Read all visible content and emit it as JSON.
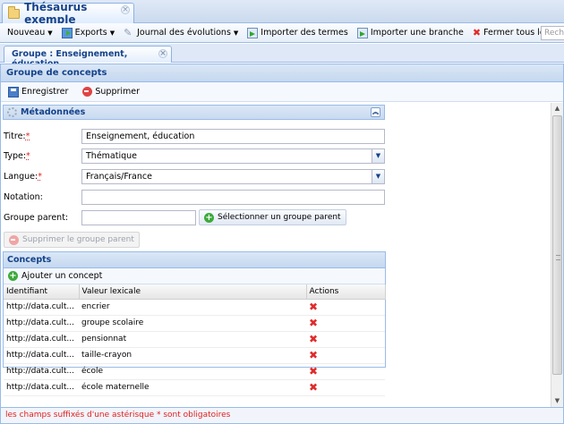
{
  "outer_tab": {
    "title": "Thésaurus exemple"
  },
  "toolbar": {
    "nouveau": "Nouveau",
    "exports": "Exports",
    "journal": "Journal des évolutions",
    "importer_termes": "Importer des termes",
    "importer_branche": "Importer une branche",
    "fermer_onglets": "Fermer tous les onglets",
    "search_placeholder": "Rech"
  },
  "inner_tab": {
    "title": "Groupe : Enseignement, éducation"
  },
  "panel": {
    "title": "Groupe de concepts",
    "save_label": "Enregistrer",
    "delete_label": "Supprimer"
  },
  "metadata": {
    "title": "Métadonnées",
    "titre_label": "Titre:",
    "titre_value": "Enseignement, éducation",
    "type_label": "Type:",
    "type_value": "Thématique",
    "langue_label": "Langue:",
    "langue_value": "Français/France",
    "notation_label": "Notation:",
    "notation_value": "",
    "parent_label": "Groupe parent:",
    "parent_value": "",
    "select_parent_label": "Sélectionner un groupe parent",
    "remove_parent_label": "Supprimer le groupe parent"
  },
  "concepts": {
    "title": "Concepts",
    "add_label": "Ajouter un concept",
    "columns": [
      "Identifiant",
      "Valeur lexicale",
      "Actions"
    ],
    "rows": [
      {
        "id": "http://data.cult...",
        "value": "encrier"
      },
      {
        "id": "http://data.cult...",
        "value": "groupe scolaire"
      },
      {
        "id": "http://data.cult...",
        "value": "pensionnat"
      },
      {
        "id": "http://data.cult...",
        "value": "taille-crayon"
      },
      {
        "id": "http://data.cult...",
        "value": "école"
      },
      {
        "id": "http://data.cult...",
        "value": "école maternelle"
      }
    ]
  },
  "footer": {
    "text": "les champs suffixés d'une astérisque * sont obligatoires"
  }
}
